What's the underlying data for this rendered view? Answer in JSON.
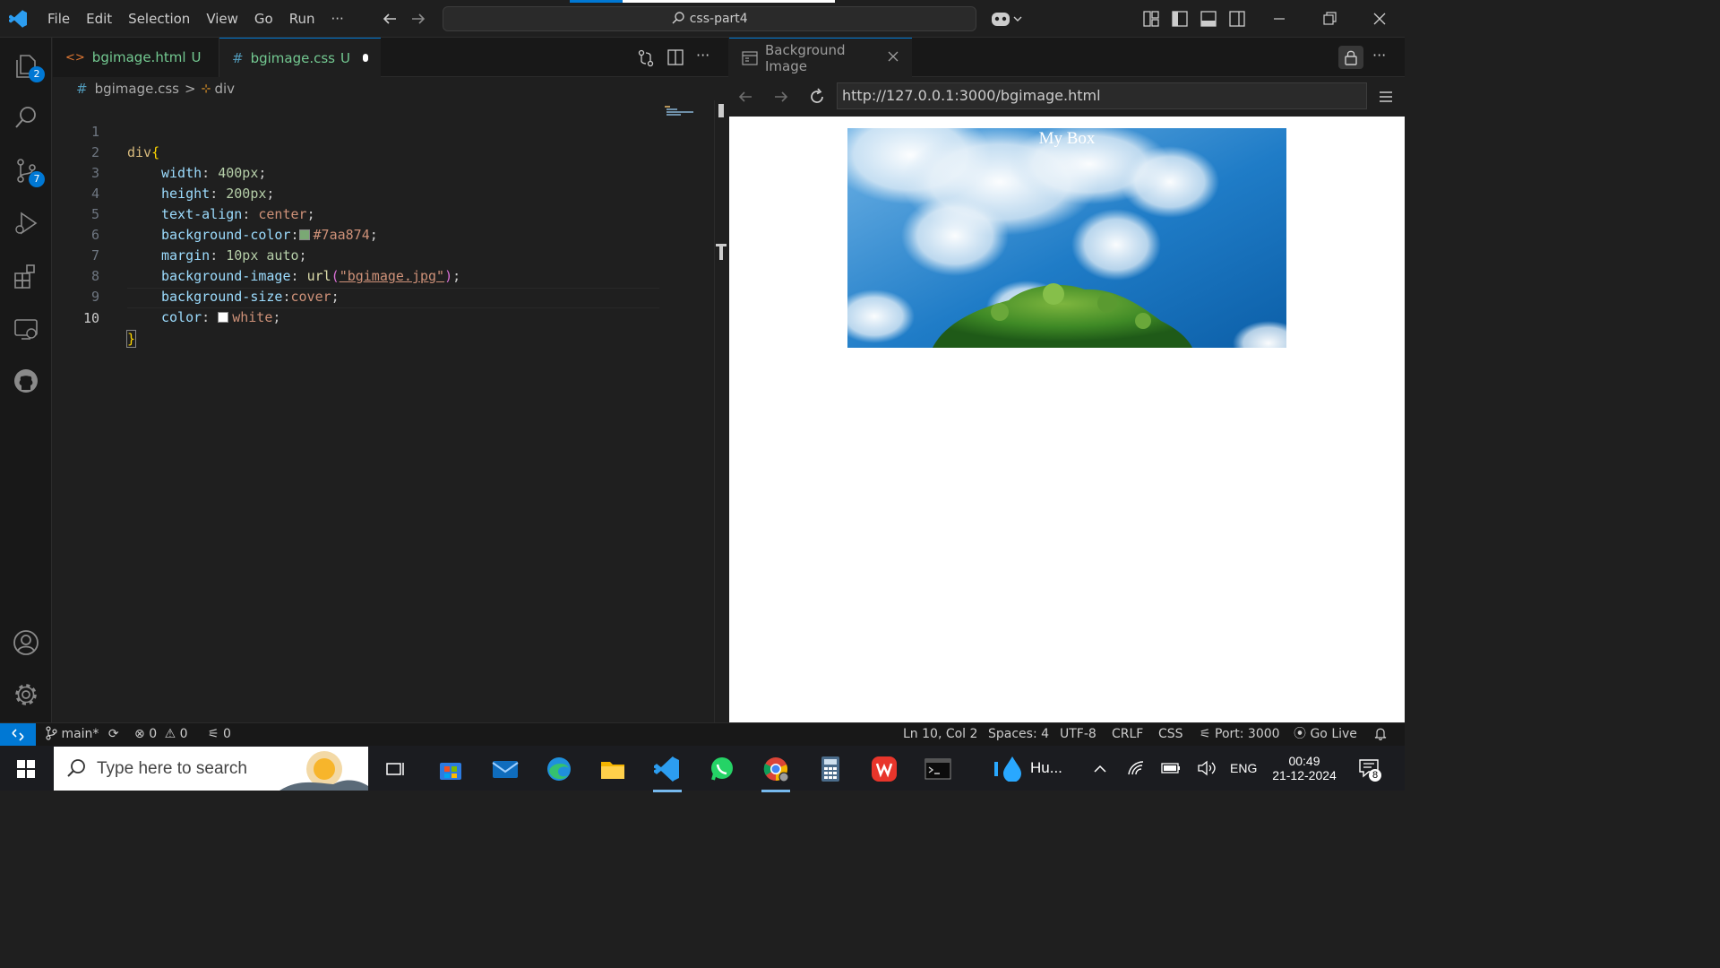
{
  "titlebar": {
    "menu": [
      "File",
      "Edit",
      "Selection",
      "View",
      "Go",
      "Run",
      "···"
    ],
    "command_center": "css-part4"
  },
  "activity": {
    "explorer_badge": "2",
    "scm_badge": "7"
  },
  "editor": {
    "tabs": [
      {
        "name": "bgimage.html",
        "status": "U",
        "icon": "html-icon"
      },
      {
        "name": "bgimage.css",
        "status": "U",
        "icon": "#"
      }
    ],
    "breadcrumb": {
      "file": "bgimage.css",
      "symbol": "div"
    },
    "lines": [
      {
        "n": "1",
        "sel": "div",
        "open": "{"
      },
      {
        "n": "2",
        "prop": "width",
        "val": "400px"
      },
      {
        "n": "3",
        "prop": "height",
        "val": "200px"
      },
      {
        "n": "4",
        "prop": "text-align",
        "val": "center"
      },
      {
        "n": "5",
        "prop": "background-color",
        "val": "#7aa874"
      },
      {
        "n": "6",
        "prop": "margin",
        "val": "10px auto"
      },
      {
        "n": "7",
        "prop": "background-image",
        "fn": "url",
        "str": "\"bgimage.jpg\""
      },
      {
        "n": "8",
        "prop": "background-size",
        "val": "cover"
      },
      {
        "n": "9",
        "prop": "color",
        "val": "white"
      },
      {
        "n": "10",
        "close": "}"
      }
    ],
    "colors": {
      "swatch_green": "#7aa874",
      "swatch_white": "#ffffff"
    }
  },
  "browser": {
    "tab_title": "Background Image",
    "url": "http://127.0.0.1:3000/bgimage.html",
    "box_text": "My Box"
  },
  "statusbar": {
    "branch": "main*",
    "errors": "0",
    "warnings": "0",
    "ports": "0",
    "position": "Ln 10, Col 2",
    "spaces": "Spaces: 4",
    "encoding": "UTF-8",
    "eol": "CRLF",
    "language": "CSS",
    "port": "Port: 3000",
    "golive": "Go Live"
  },
  "taskbar": {
    "search_placeholder": "Type here to search",
    "weather_label": "Hu...",
    "lang": "ENG",
    "time": "00:49",
    "date": "21-12-2024",
    "notifications": "8"
  }
}
